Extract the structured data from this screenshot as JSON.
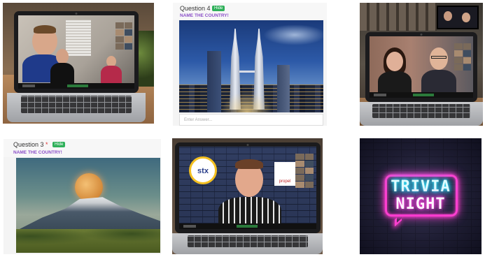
{
  "photos": {
    "laptop_couple": {
      "alt_icon": "video-call-photo"
    },
    "laptop_pair": {
      "alt_icon": "video-call-photo"
    },
    "laptop_host": {
      "logo_text": "stx",
      "sign_text": "propel"
    }
  },
  "quiz_q4": {
    "question_label": "Question 4",
    "required_mark": "*",
    "hide_label": "Hide",
    "prompt": "NAME THE COUNTRY!",
    "answer_placeholder": "Enter Answer..."
  },
  "quiz_q3": {
    "question_label": "Question 3",
    "required_mark": "*",
    "hide_label": "Hide",
    "prompt": "NAME THE COUNTRY!"
  },
  "trivia_sign": {
    "line1": "TRIVIA",
    "line2": "NIGHT"
  },
  "colors": {
    "neon_cyan": "#35e8ff",
    "neon_pink": "#ff3fd0",
    "hide_button": "#2fb05a",
    "prompt_purple": "#8b4fc8"
  }
}
